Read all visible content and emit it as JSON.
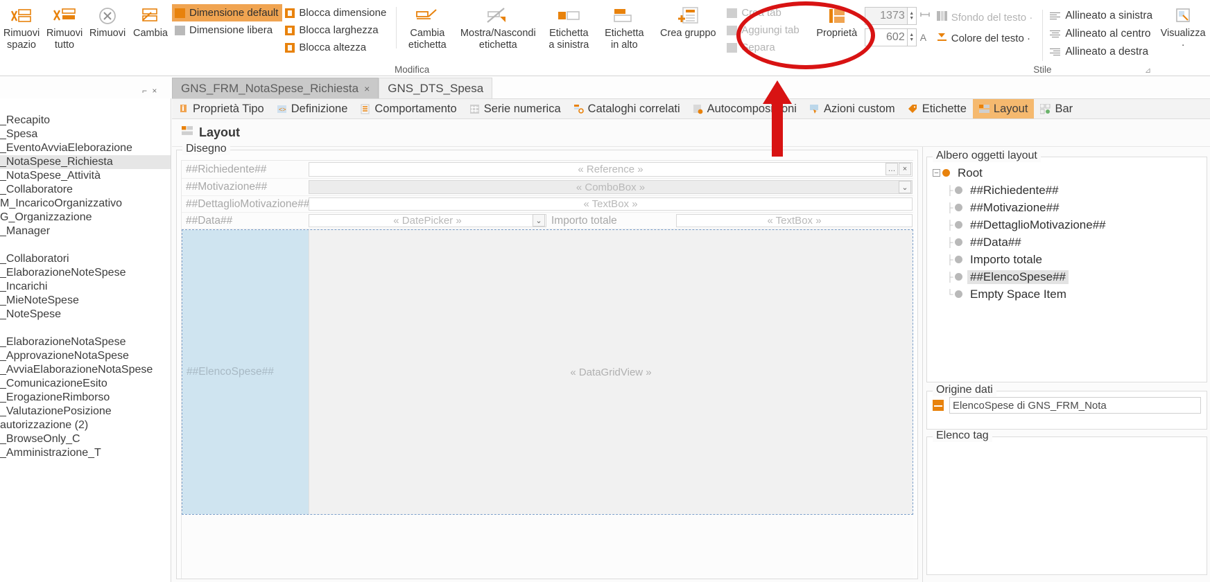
{
  "ribbon": {
    "groups": [
      {
        "title": "",
        "buttons": [
          {
            "label_l1": "Rimuovi",
            "label_l2": "spazio",
            "icon": "remove-space-icon"
          },
          {
            "label_l1": "Rimuovi",
            "label_l2": "tutto",
            "icon": "remove-all-icon"
          },
          {
            "label_l1": "Rimuovi",
            "label_l2": "",
            "icon": "remove-circle-icon"
          },
          {
            "label_l1": "Cambia",
            "label_l2": "",
            "icon": "change-icon"
          }
        ]
      },
      {
        "title": "Modifica",
        "toggles_a": [
          {
            "label": "Dimensione default",
            "selected": true,
            "icon": "default-size-icon"
          },
          {
            "label": "Dimensione libera",
            "selected": false,
            "icon": "free-size-icon"
          }
        ],
        "toggles_b": [
          {
            "label": "Blocca dimensione",
            "icon": "lock-size-icon"
          },
          {
            "label": "Blocca larghezza",
            "icon": "lock-width-icon"
          },
          {
            "label": "Blocca altezza",
            "icon": "lock-height-icon"
          }
        ],
        "buttons": [
          {
            "label_l1": "Cambia",
            "label_l2": "etichetta",
            "icon": "change-label-icon"
          },
          {
            "label_l1": "Mostra/Nascondi",
            "label_l2": "etichetta",
            "icon": "toggle-label-icon"
          },
          {
            "label_l1": "Etichetta",
            "label_l2": "a sinistra",
            "icon": "label-left-icon"
          },
          {
            "label_l1": "Etichetta",
            "label_l2": "in alto",
            "icon": "label-top-icon"
          }
        ]
      },
      {
        "title": "",
        "buttons": [
          {
            "label_l1": "Crea gruppo",
            "label_l2": "",
            "icon": "create-group-icon"
          }
        ],
        "toggles_c": [
          {
            "label": "Crea tab",
            "disabled": true,
            "icon": "create-tab-icon"
          },
          {
            "label": "Aggiungi tab",
            "disabled": true,
            "icon": "add-tab-icon"
          },
          {
            "label": "Separa",
            "disabled": true,
            "icon": "split-icon"
          }
        ]
      },
      {
        "title": "",
        "properties_label": "Proprietà",
        "properties_icon": "properties-icon",
        "width_value": "1373",
        "height_value": "602",
        "width_unit_icon": "width-unit-icon",
        "height_unit_label": "A"
      },
      {
        "title": "Stile",
        "style_items": [
          {
            "label": "Sfondo del testo ·",
            "disabled": true,
            "icon": "text-background-icon"
          },
          {
            "label": "Colore del testo ·",
            "disabled": false,
            "icon": "text-color-icon"
          }
        ],
        "align_items": [
          {
            "label": "Allineato a sinistra",
            "icon": "align-left-icon"
          },
          {
            "label": "Allineato al centro",
            "icon": "align-center-icon"
          },
          {
            "label": "Allineato a destra",
            "icon": "align-right-icon"
          }
        ],
        "dialog_launcher": "⊿"
      },
      {
        "title": "",
        "buttons": [
          {
            "label_l1": "Visualizza",
            "label_l2": "·",
            "icon": "view-icon"
          }
        ]
      }
    ]
  },
  "doc_tabs": [
    {
      "label": "GNS_FRM_NotaSpese_Richiesta",
      "active": true,
      "close": "×"
    },
    {
      "label": "GNS_DTS_Spesa",
      "active": false,
      "close": ""
    }
  ],
  "nav": {
    "items": [
      {
        "label": "Proprietà Tipo",
        "icon": "info-icon",
        "active": false
      },
      {
        "label": "Definizione",
        "icon": "definition-icon",
        "active": false
      },
      {
        "label": "Comportamento",
        "icon": "behavior-icon",
        "active": false
      },
      {
        "label": "Serie numerica",
        "icon": "number-series-icon",
        "active": false
      },
      {
        "label": "Cataloghi correlati",
        "icon": "related-catalogs-icon",
        "active": false
      },
      {
        "label": "Autocomposizioni",
        "icon": "wizard-icon",
        "active": false
      },
      {
        "label": "Azioni custom",
        "icon": "custom-actions-icon",
        "active": false
      },
      {
        "label": "Etichette",
        "icon": "labels-icon",
        "active": false
      },
      {
        "label": "Layout",
        "icon": "layout-icon",
        "active": true
      },
      {
        "label": "Bar",
        "icon": "bar-icon",
        "active": false
      }
    ]
  },
  "page_header": {
    "title": "Layout",
    "icon": "layout-icon"
  },
  "sidebar": {
    "items": [
      {
        "label": "_Recapito",
        "selected": false
      },
      {
        "label": "_Spesa",
        "selected": false
      },
      {
        "label": "_EventoAvviaEleborazione",
        "selected": false
      },
      {
        "label": "_NotaSpese_Richiesta",
        "selected": true
      },
      {
        "label": "_NotaSpese_Attività",
        "selected": false
      },
      {
        "label": "_Collaboratore",
        "selected": false
      },
      {
        "label": "M_IncaricoOrganizzativo",
        "selected": false
      },
      {
        "label": "G_Organizzazione",
        "selected": false
      },
      {
        "label": "_Manager",
        "selected": false
      },
      {
        "label": "",
        "selected": false
      },
      {
        "label": "_Collaboratori",
        "selected": false
      },
      {
        "label": "_ElaborazioneNoteSpese",
        "selected": false
      },
      {
        "label": "_Incarichi",
        "selected": false
      },
      {
        "label": "_MieNoteSpese",
        "selected": false
      },
      {
        "label": "_NoteSpese",
        "selected": false
      },
      {
        "label": "",
        "selected": false
      },
      {
        "label": "_ElaborazioneNotaSpese",
        "selected": false
      },
      {
        "label": "_ApprovazioneNotaSpese",
        "selected": false
      },
      {
        "label": "_AvviaElaborazioneNotaSpese",
        "selected": false
      },
      {
        "label": "_ComunicazioneEsito",
        "selected": false
      },
      {
        "label": "_ErogazioneRimborso",
        "selected": false
      },
      {
        "label": "_ValutazionePosizione",
        "selected": false
      },
      {
        "label": "autorizzazione (2)",
        "selected": false
      },
      {
        "label": "_BrowseOnly_C",
        "selected": false
      },
      {
        "label": "_Amministrazione_T",
        "selected": false
      }
    ]
  },
  "designer": {
    "group_caption": "Disegno",
    "rows": [
      {
        "label": "##Richiedente##",
        "placeholder": "« Reference »",
        "kind": "reference",
        "buttons": [
          "…",
          "×"
        ]
      },
      {
        "label": "##Motivazione##",
        "placeholder": "« ComboBox »",
        "kind": "combobox",
        "buttons": [
          "⌄"
        ]
      },
      {
        "label": "##DettaglioMotivazione##",
        "placeholder": "« TextBox »",
        "kind": "textbox",
        "buttons": []
      }
    ],
    "data_row": {
      "label": "##Data##",
      "date_placeholder": "« DatePicker »",
      "date_button": "⌄",
      "amount_label": "Importo totale",
      "amount_placeholder": "« TextBox »"
    },
    "grid": {
      "label": "##ElencoSpese##",
      "placeholder": "« DataGridView »"
    }
  },
  "right_panel": {
    "tree_caption": "Albero oggetti layout",
    "tree": [
      {
        "label": "Root",
        "level": 0,
        "expander": "–",
        "root": true,
        "selected": false
      },
      {
        "label": "##Richiedente##",
        "level": 1,
        "selected": false
      },
      {
        "label": "##Motivazione##",
        "level": 1,
        "selected": false
      },
      {
        "label": "##DettaglioMotivazione##",
        "level": 1,
        "selected": false
      },
      {
        "label": "##Data##",
        "level": 1,
        "selected": false
      },
      {
        "label": "Importo totale",
        "level": 1,
        "selected": false
      },
      {
        "label": "##ElencoSpese##",
        "level": 1,
        "selected": true
      },
      {
        "label": "Empty Space Item",
        "level": 1,
        "selected": false
      }
    ],
    "origine_caption": "Origine dati",
    "origine_value": "ElencoSpese di GNS_FRM_Nota",
    "tag_caption": "Elenco tag"
  },
  "annotations": {
    "ellipse_color": "#d81313",
    "arrow_color": "#d81313"
  }
}
